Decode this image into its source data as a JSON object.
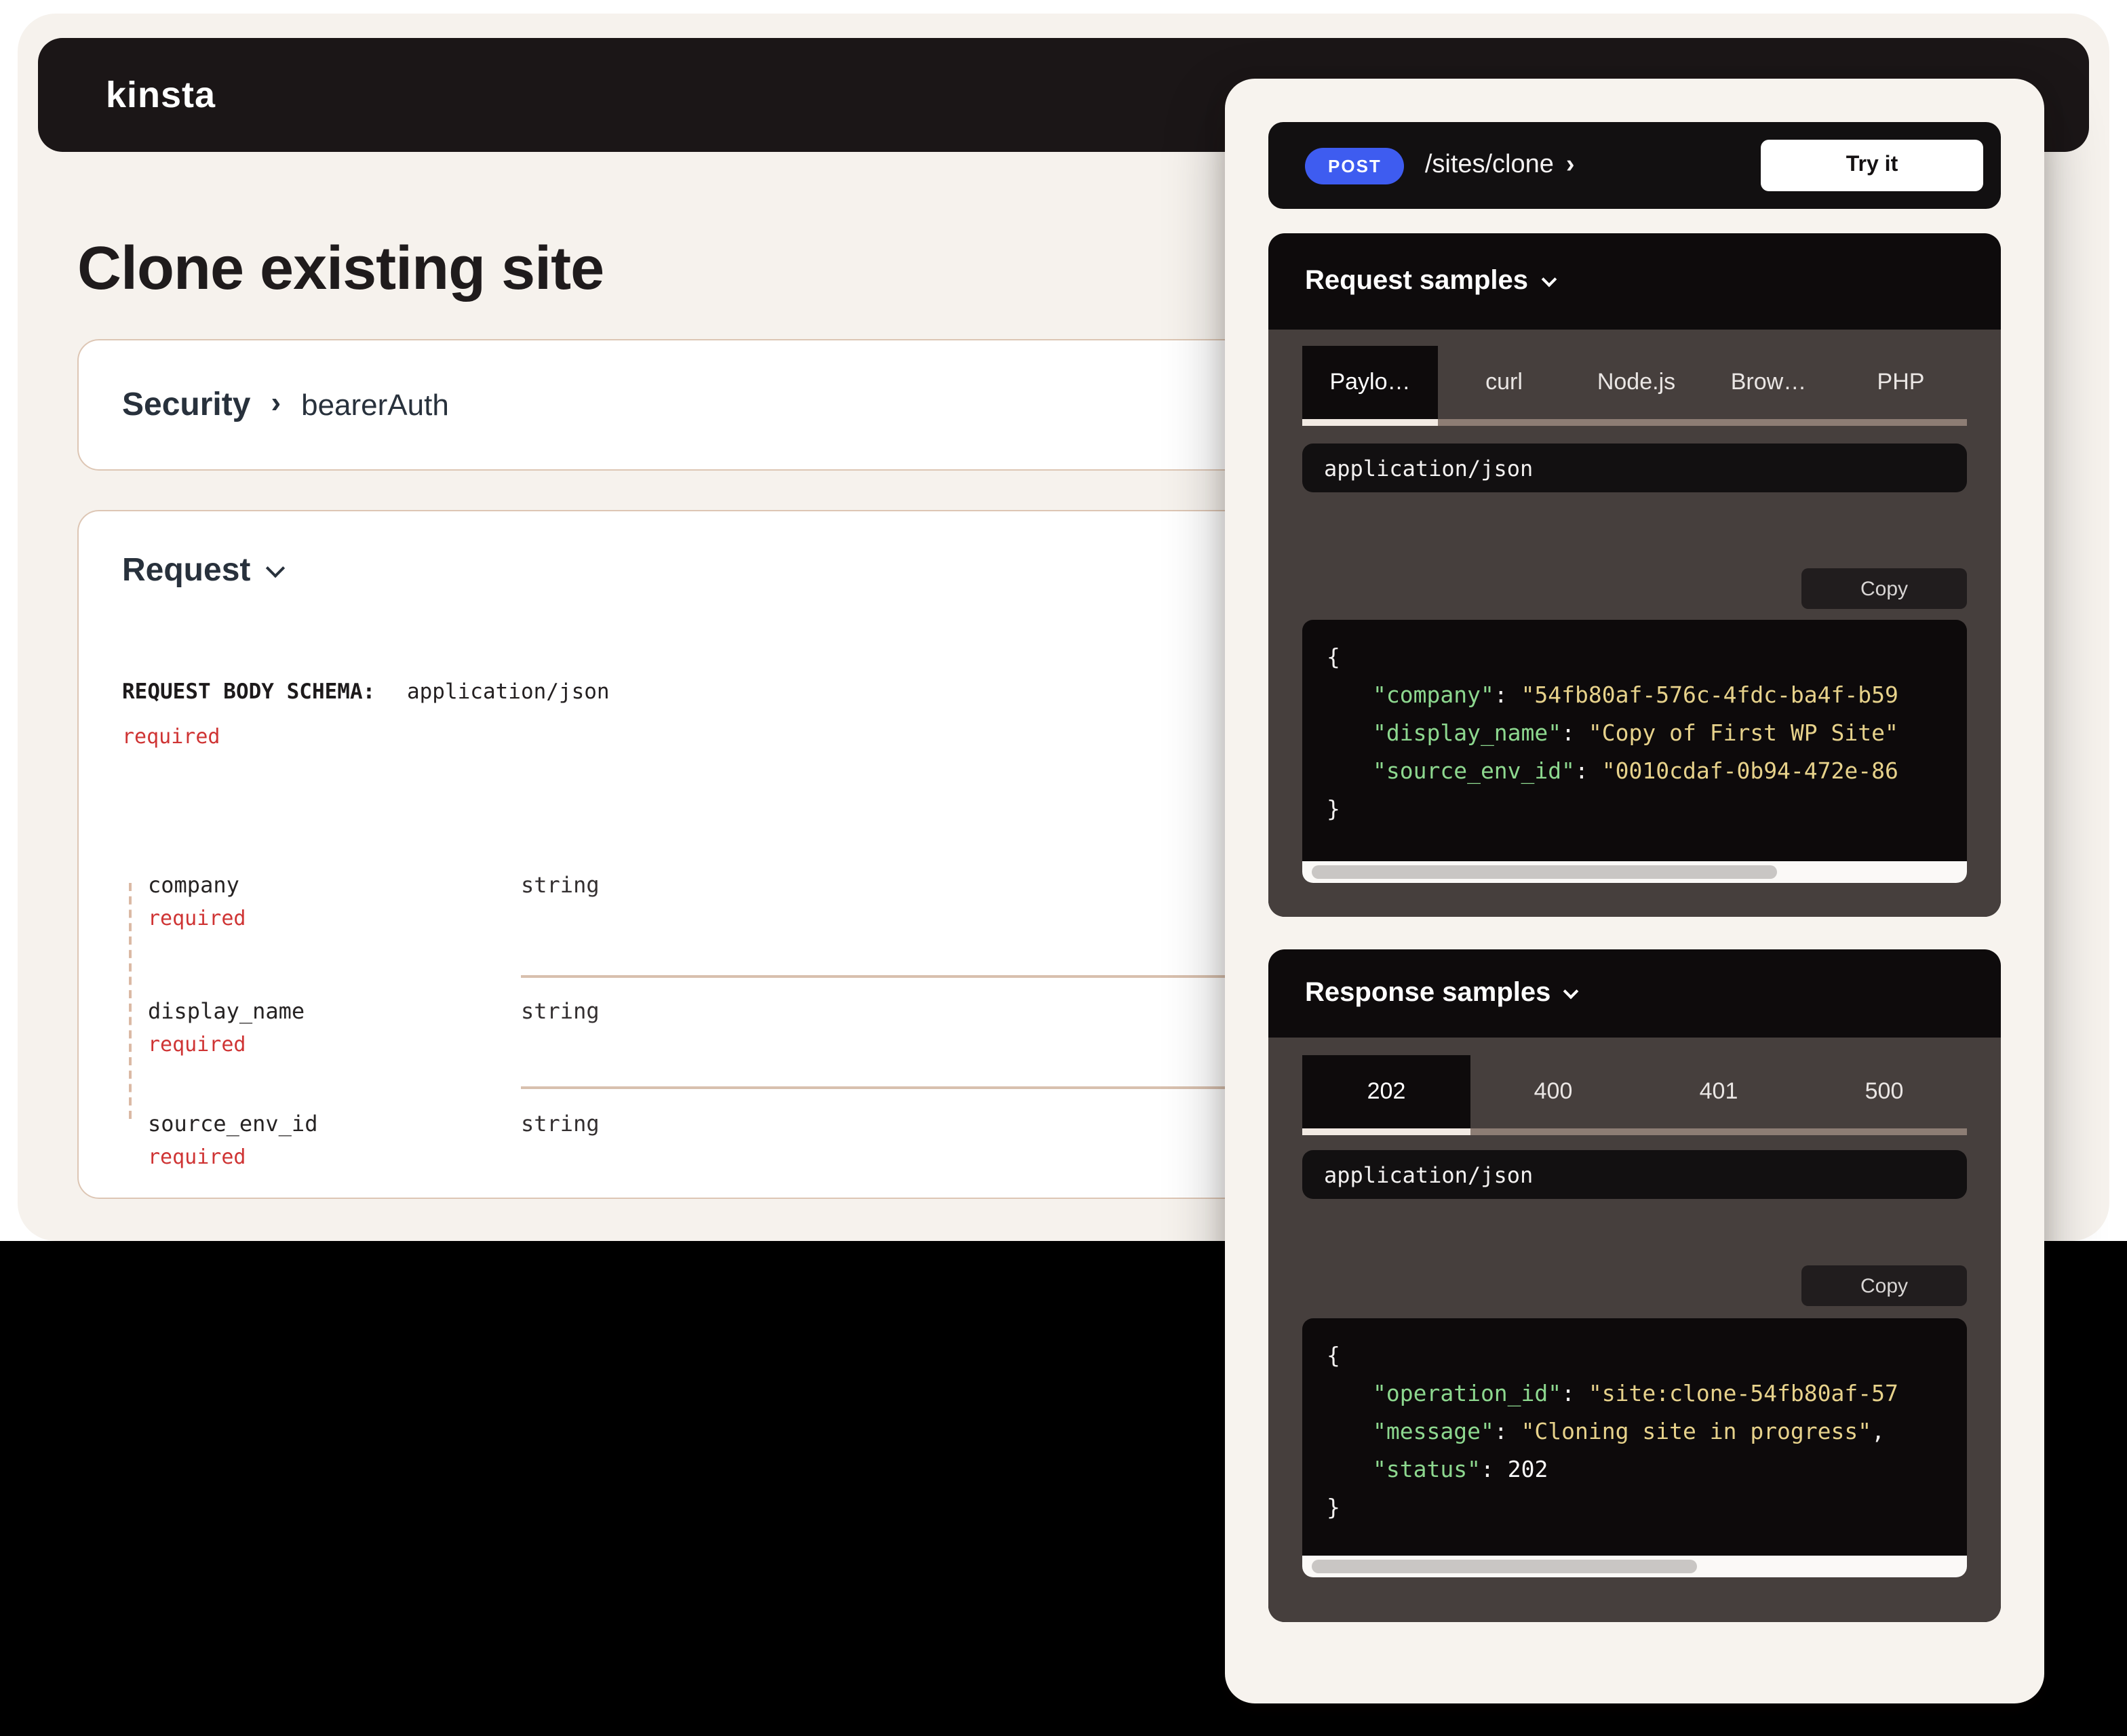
{
  "header": {
    "logo_text": "kinsta"
  },
  "page": {
    "title": "Clone existing site"
  },
  "security_card": {
    "title": "Security",
    "chevron": "›",
    "auth_method": "bearerAuth"
  },
  "request_card": {
    "title": "Request",
    "schema_label": "REQUEST BODY SCHEMA:",
    "schema_content_type": "application/json",
    "schema_required": "required",
    "fields": [
      {
        "name": "company",
        "flag": "required",
        "type": "string"
      },
      {
        "name": "display_name",
        "flag": "required",
        "type": "string"
      },
      {
        "name": "source_env_id",
        "flag": "required",
        "type": "string"
      }
    ]
  },
  "api_panel": {
    "endpoint": {
      "method": "POST",
      "path": "/sites/clone",
      "chevron": "›",
      "try_it_label": "Try it"
    },
    "request_samples": {
      "title": "Request samples",
      "tabs": [
        "Paylo…",
        "curl",
        "Node.js",
        "Brow…",
        "PHP"
      ],
      "active_tab": "Paylo…",
      "content_type": "application/json",
      "copy_label": "Copy",
      "code": {
        "open_brace": "{",
        "close_brace": "}",
        "lines": [
          {
            "key": "\"company\"",
            "colon": ": ",
            "value": "\"54fb80af-576c-4fdc-ba4f-b59"
          },
          {
            "key": "\"display_name\"",
            "colon": ": ",
            "value": "\"Copy of First WP Site\""
          },
          {
            "key": "\"source_env_id\"",
            "colon": ": ",
            "value": "\"0010cdaf-0b94-472e-86"
          }
        ]
      }
    },
    "response_samples": {
      "title": "Response samples",
      "tabs": [
        "202",
        "400",
        "401",
        "500"
      ],
      "active_tab": "202",
      "content_type": "application/json",
      "copy_label": "Copy",
      "code": {
        "open_brace": "{",
        "close_brace": "}",
        "lines": [
          {
            "key": "\"operation_id\"",
            "colon": ": ",
            "value": "\"site:clone-54fb80af-57"
          },
          {
            "key": "\"message\"",
            "colon": ": ",
            "value": "\"Cloning site in progress\"",
            "trailing": ","
          },
          {
            "key": "\"status\"",
            "colon": ": ",
            "number": "202"
          }
        ]
      }
    }
  },
  "colors": {
    "method_post_badge": "#3E5CF0",
    "required_text": "#CF3434",
    "code_key_green": "#8DD88F",
    "code_string_yellow": "#E7D28B",
    "active_tab_underline": "#F2EAE3",
    "inactive_tab_track": "#8D7D74"
  }
}
